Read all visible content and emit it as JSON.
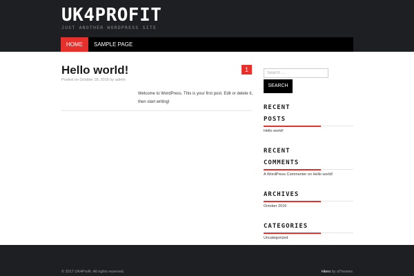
{
  "site": {
    "title": "UK4PROFIT",
    "description": "JUST ANOTHER WORDPRESS SITE"
  },
  "nav": {
    "items": [
      {
        "label": "HOME"
      },
      {
        "label": "SAMPLE PAGE"
      }
    ]
  },
  "post": {
    "title": "Hello world!",
    "comment_count": "1",
    "meta_prefix": "Posted on",
    "date": "October 18, 2016",
    "meta_by": "by",
    "author": "admin",
    "body": "Welcome to WordPress. This is your first post. Edit or delete it, then start writing!"
  },
  "sidebar": {
    "search_placeholder": "Search …",
    "search_button": "SEARCH",
    "recent_posts_title_1": "RECENT",
    "recent_posts_title_2": "POSTS",
    "recent_posts": [
      "Hello world!"
    ],
    "recent_comments_title_1": "RECENT",
    "recent_comments_title_2": "COMMENTS",
    "recent_comment": {
      "author": "A WordPress Commenter",
      "on": "on",
      "post": "Hello world!"
    },
    "archives_title": "ARCHIVES",
    "archives": [
      "October 2016"
    ],
    "categories_title": "CATEGORIES",
    "categories": [
      "Uncategorized"
    ]
  },
  "footer": {
    "copyright": "© 2017 UK4Profit. All rights reserved.",
    "theme_name": "Hiero",
    "by": "by",
    "theme_author": "aThemes"
  },
  "colors": {
    "accent": "#e5302c",
    "header_bg": "#1e1f23",
    "nav_bg": "#000000"
  }
}
